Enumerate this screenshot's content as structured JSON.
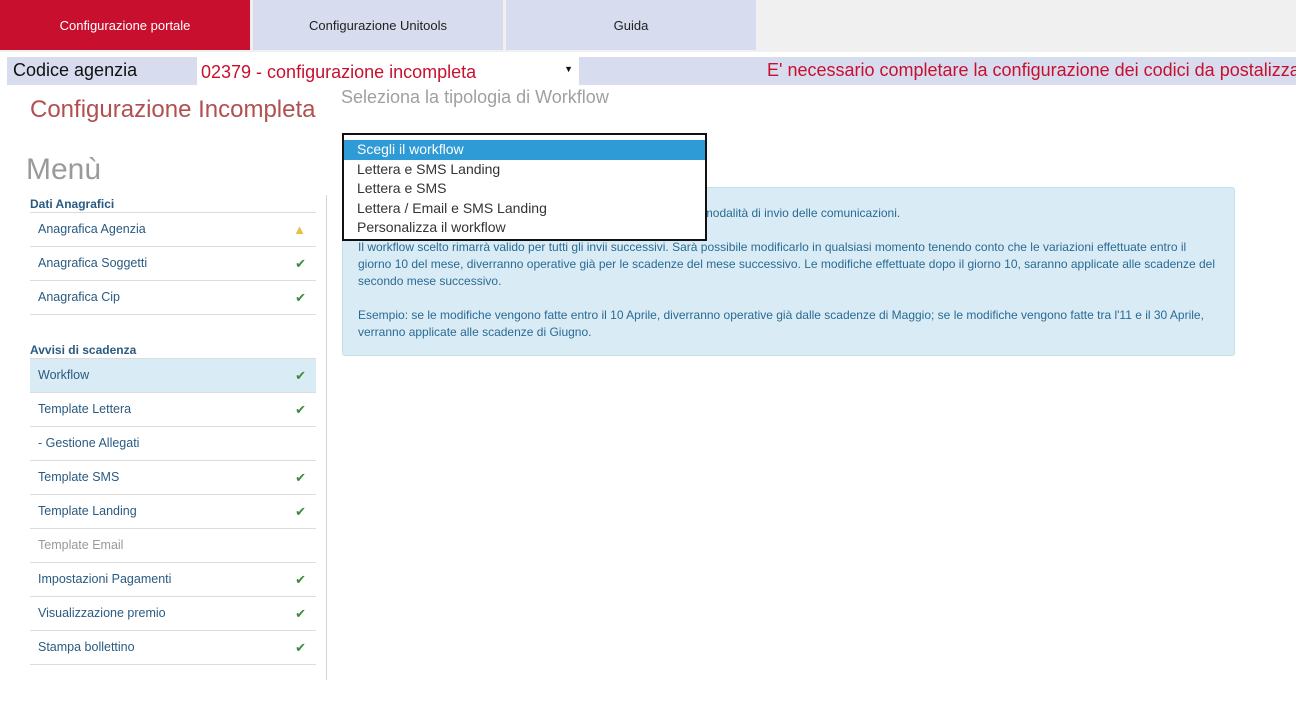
{
  "top_tabs": [
    {
      "label": "Configurazione portale"
    },
    {
      "label": "Configurazione Unitools"
    },
    {
      "label": "Guida"
    }
  ],
  "agency": {
    "label": "Codice agenzia",
    "selected": "02379 - configurazione incompleta",
    "message": "E' necessario completare la configurazione dei codici da postalizzare"
  },
  "sidebar": {
    "page_title": "Configurazione Incompleta",
    "menu_title": "Menù",
    "section1_title": "Dati Anagrafici",
    "section1_items": [
      {
        "label": "Anagrafica Agenzia",
        "status": "warning"
      },
      {
        "label": "Anagrafica Soggetti",
        "status": "ok"
      },
      {
        "label": "Anagrafica Cip",
        "status": "ok"
      }
    ],
    "section2_title": "Avvisi di scadenza",
    "section2_items": [
      {
        "label": "Workflow",
        "status": "ok",
        "active": true
      },
      {
        "label": "Template Lettera",
        "status": "ok"
      },
      {
        "label": "- Gestione Allegati",
        "status": "none"
      },
      {
        "label": "Template SMS",
        "status": "ok"
      },
      {
        "label": "Template Landing",
        "status": "ok"
      },
      {
        "label": "Template Email",
        "status": "none",
        "disabled": true
      },
      {
        "label": "Impostazioni Pagamenti",
        "status": "ok"
      },
      {
        "label": "Visualizzazione premio",
        "status": "ok"
      },
      {
        "label": "Stampa bollettino",
        "status": "ok"
      }
    ]
  },
  "main": {
    "heading": "Seleziona la tipologia di Workflow",
    "info_paragraph1": "                                                                     scegliere i canali e le modalità di invio delle comunicazioni.",
    "info_paragraph2": "Il workflow scelto rimarrà valido per tutti gli invii successivi. Sarà possibile modificarlo in qualsiasi momento tenendo conto che le variazioni effettuate entro il giorno 10 del mese, diverranno operative già per le scadenze del mese successivo. Le modifiche effettuate dopo il giorno 10, saranno applicate alle scadenze del secondo mese successivo.",
    "info_paragraph3": "Esempio: se le modifiche vengono fatte entro il 10 Aprile, diverranno operative già dalle scadenze di Maggio; se le modifiche vengono fatte tra l'11 e il 30 Aprile, verranno applicate alle scadenze di Giugno.",
    "workflow_options": [
      "Scegli il workflow",
      "Lettera e SMS Landing",
      "Lettera e SMS",
      "Lettera / Email e SMS Landing",
      "Personalizza il workflow"
    ]
  },
  "icons": {
    "ok": "check-icon",
    "warning": "warning-icon"
  },
  "colors": {
    "brand_red": "#c8102e",
    "tab_bg": "#d7dcef",
    "active_item_bg": "#d9ecf5",
    "check_green": "#3c8a3c",
    "selected_option": "#2e9bd6"
  }
}
